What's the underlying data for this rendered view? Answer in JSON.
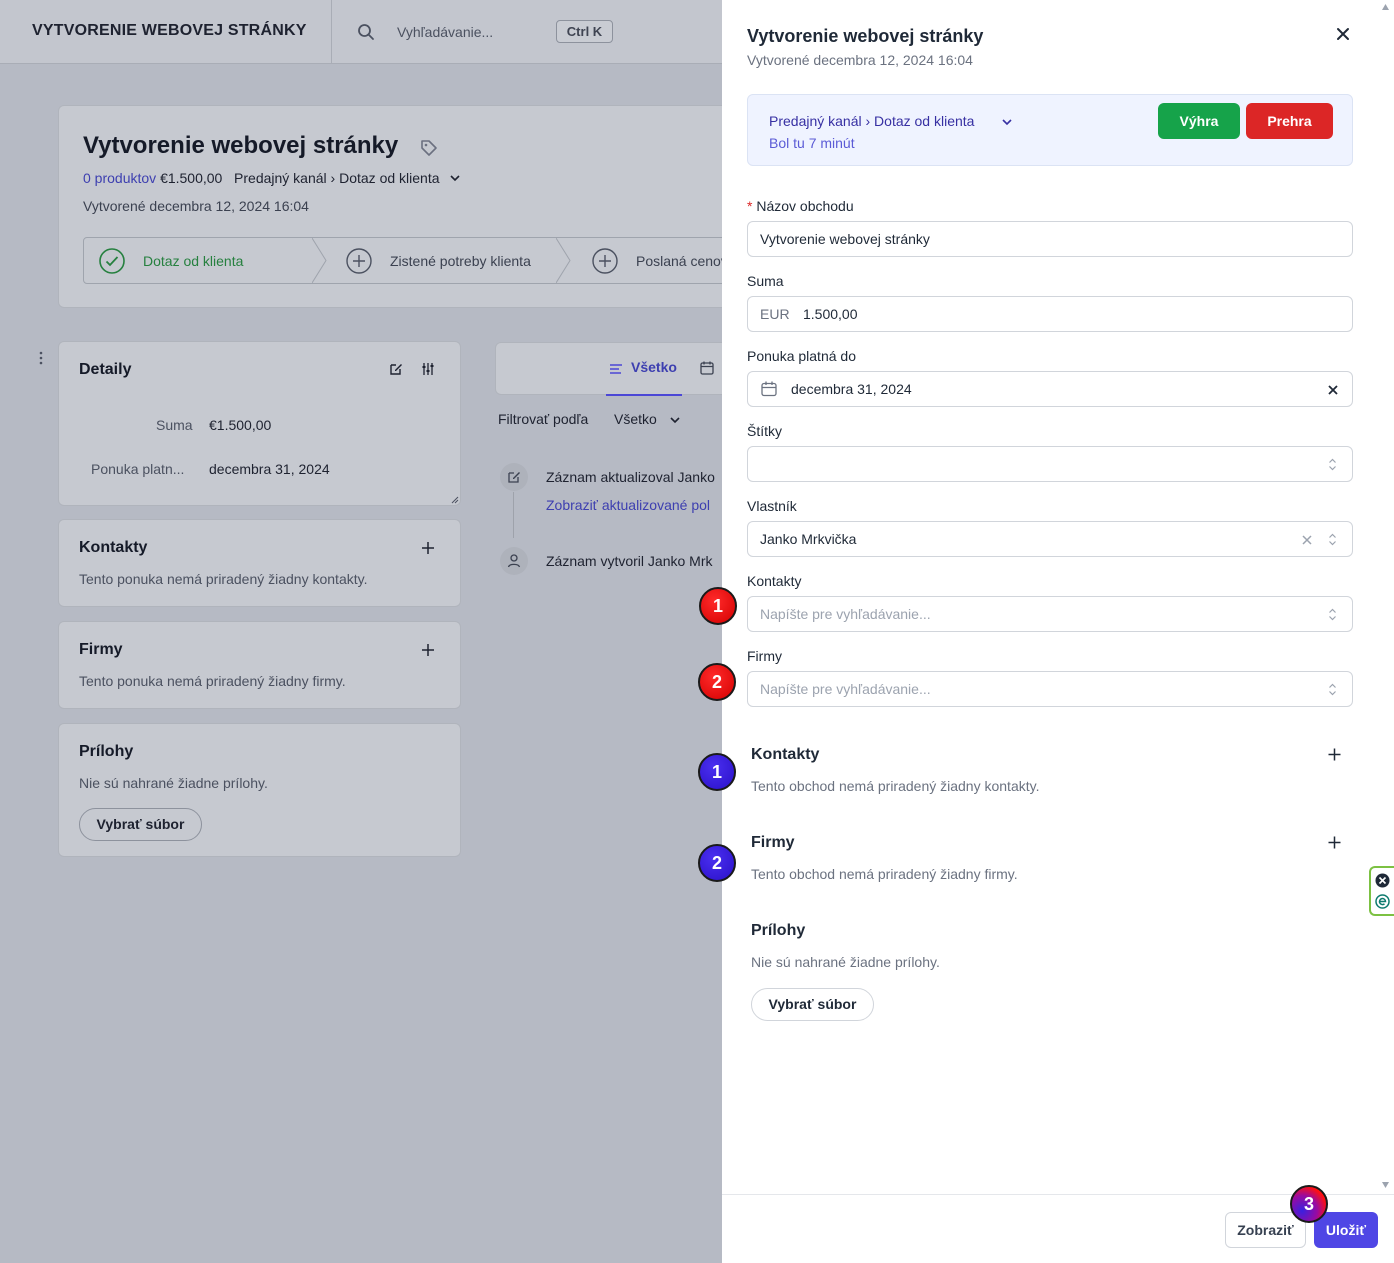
{
  "topbar": {
    "app_title": "VYTVORENIE WEBOVEJ STRÁNKY",
    "search_placeholder": "Vyhľadávanie...",
    "shortcut": "Ctrl K"
  },
  "deal": {
    "title": "Vytvorenie webovej stránky",
    "products_link": "0 produktov",
    "amount": "€1.500,00",
    "pipeline": "Predajný kanál",
    "stage": "Dotaz od klienta",
    "created": "Vytvorené decembra 12, 2024 16:04",
    "stages": [
      {
        "label": "Dotaz od klienta",
        "state": "done"
      },
      {
        "label": "Zistené potreby klienta",
        "state": "todo"
      },
      {
        "label": "Poslaná cenová",
        "state": "todo"
      }
    ]
  },
  "details": {
    "title": "Detaily",
    "rows": [
      {
        "label": "Suma",
        "value": "€1.500,00"
      },
      {
        "label": "Ponuka platn...",
        "value": "decembra 31, 2024"
      }
    ]
  },
  "bg_contacts": {
    "title": "Kontakty",
    "empty": "Tento ponuka nemá priradený žiadny kontakty."
  },
  "bg_firms": {
    "title": "Firmy",
    "empty": "Tento ponuka nemá priradený žiadny firmy."
  },
  "bg_attachments": {
    "title": "Prílohy",
    "empty": "Nie sú nahrané žiadne prílohy.",
    "button": "Vybrať súbor"
  },
  "activity": {
    "tab_all": "Všetko",
    "filter_label": "Filtrovať podľa",
    "filter_value": "Všetko",
    "items": [
      {
        "text": "Záznam aktualizoval Janko",
        "link": "Zobraziť aktualizované pol"
      },
      {
        "text": "Záznam vytvoril Janko Mrk"
      }
    ]
  },
  "drawer": {
    "title": "Vytvorenie webovej stránky",
    "subtitle": "Vytvorené decembra 12, 2024 16:04",
    "pipeline_path": "Predajný kanál  ›  Dotaz od klienta",
    "time_in_stage": "Bol tu 7 minút",
    "win_label": "Výhra",
    "lose_label": "Prehra",
    "fields": {
      "name_label": "Názov obchodu",
      "name_value": "Vytvorenie webovej stránky",
      "amount_label": "Suma",
      "currency": "EUR",
      "amount_value": "1.500,00",
      "valid_label": "Ponuka platná do",
      "valid_value": "decembra 31, 2024",
      "tags_label": "Štítky",
      "owner_label": "Vlastník",
      "owner_value": "Janko Mrkvička",
      "contacts_label": "Kontakty",
      "contacts_placeholder": "Napíšte pre vyhľadávanie...",
      "firms_label": "Firmy",
      "firms_placeholder": "Napíšte pre vyhľadávanie..."
    },
    "sections": {
      "contacts_title": "Kontakty",
      "contacts_empty": "Tento obchod nemá priradený žiadny kontakty.",
      "firms_title": "Firmy",
      "firms_empty": "Tento obchod nemá priradený žiadny firmy.",
      "attachments_title": "Prílohy",
      "attachments_empty": "Nie sú nahrané žiadne prílohy.",
      "attachments_button": "Vybrať súbor"
    },
    "footer": {
      "show_label": "Zobraziť",
      "save_label": "Uložiť"
    }
  },
  "markers": [
    "1",
    "2",
    "1",
    "2",
    "3"
  ],
  "colors": {
    "accent": "#4f46e5",
    "win": "#16a34a",
    "lose": "#dc2626",
    "stage_done": "#26803f"
  }
}
